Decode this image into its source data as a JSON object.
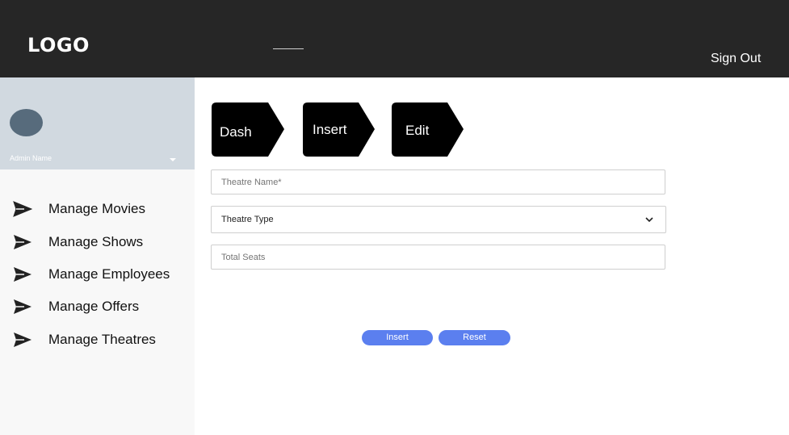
{
  "header": {
    "logo": "LOGO",
    "sign_out": "Sign Out"
  },
  "sidebar": {
    "admin_name": "Admin Name",
    "items": [
      {
        "label": "Manage Movies",
        "icon": "send-icon"
      },
      {
        "label": "Manage Shows",
        "icon": "send-icon"
      },
      {
        "label": "Manage Employees",
        "icon": "send-icon"
      },
      {
        "label": "Manage Offers",
        "icon": "send-icon"
      },
      {
        "label": "Manage Theatres",
        "icon": "send-icon"
      }
    ]
  },
  "tabs": [
    {
      "label": "Dash"
    },
    {
      "label": "Insert"
    },
    {
      "label": "Edit"
    }
  ],
  "form": {
    "theatre_name": {
      "placeholder": "Theatre Name*",
      "value": ""
    },
    "theatre_type": {
      "selected": "Theatre Type"
    },
    "total_seats": {
      "placeholder": "Total Seats",
      "value": ""
    }
  },
  "buttons": {
    "insert": "Insert",
    "reset": "Reset"
  },
  "colors": {
    "header_bg": "#262626",
    "profile_bg": "#d1d9e0",
    "sidebar_bg": "#f8f8f8",
    "avatar": "#576b7c",
    "tab_bg": "#000000",
    "button_bg": "#5b7fef"
  }
}
